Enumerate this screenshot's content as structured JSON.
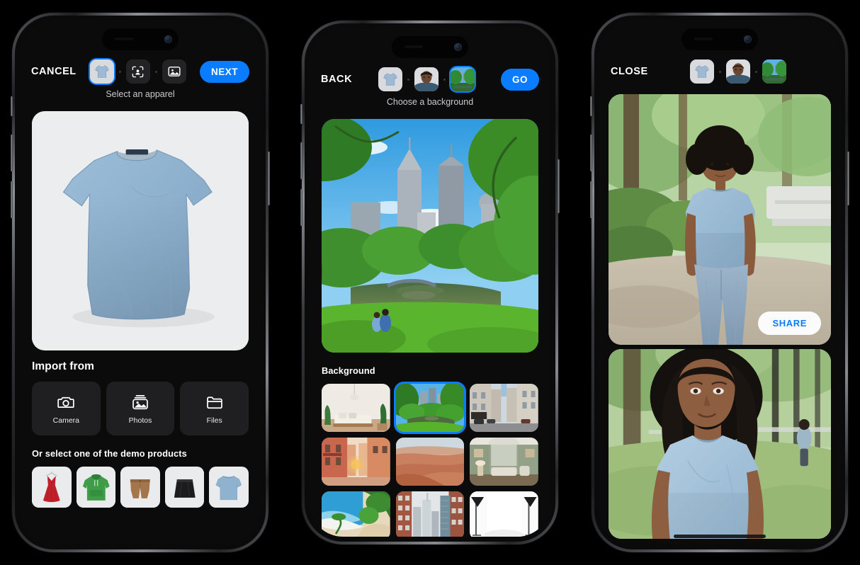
{
  "app": {
    "accent": "#0a7cff",
    "screen_bg": "#0b0b0c",
    "shirt_color": "#8fb2cf"
  },
  "phone1": {
    "nav_label": "CANCEL",
    "cta_label": "NEXT",
    "caption": "Select an apparel",
    "chips": [
      {
        "name": "apparel-chip",
        "icon": "tshirt-thumbnail",
        "selected": true
      },
      {
        "name": "model-chip",
        "icon": "face-scan-icon",
        "selected": false
      },
      {
        "name": "background-chip",
        "icon": "image-icon",
        "selected": false
      }
    ],
    "preview_alt": "light blue crew-neck t-shirt on white background",
    "import_title": "Import from",
    "import_options": [
      {
        "label": "Camera",
        "icon": "camera-icon"
      },
      {
        "label": "Photos",
        "icon": "photos-icon"
      },
      {
        "label": "Files",
        "icon": "folder-icon"
      }
    ],
    "demo_title": "Or select one of the demo products",
    "demo_products": [
      {
        "name": "red-dress",
        "color": "#c0202a"
      },
      {
        "name": "green-hoodie",
        "color": "#3d9a46"
      },
      {
        "name": "brown-shorts",
        "color": "#a3764c"
      },
      {
        "name": "black-skirt",
        "color": "#1d1d1f"
      },
      {
        "name": "blue-tshirt",
        "color": "#8fb2cf"
      }
    ]
  },
  "phone2": {
    "nav_label": "BACK",
    "cta_label": "GO",
    "caption": "Choose a background",
    "chips": [
      {
        "name": "apparel-chip",
        "icon": "tshirt-thumbnail",
        "selected": false
      },
      {
        "name": "model-chip",
        "icon": "model-portrait",
        "selected": false
      },
      {
        "name": "background-chip",
        "icon": "park-thumbnail",
        "selected": true
      }
    ],
    "hero_alt": "city park with lake, bridge and skyscrapers framed by green trees",
    "section_title": "Background",
    "backgrounds": [
      {
        "name": "bright-living-room",
        "selected": false
      },
      {
        "name": "city-park-lake",
        "selected": true
      },
      {
        "name": "paris-street",
        "selected": false
      },
      {
        "name": "italian-alley",
        "selected": false
      },
      {
        "name": "desert-dunes",
        "selected": false
      },
      {
        "name": "classic-green-lounge",
        "selected": false
      },
      {
        "name": "tropical-beach",
        "selected": false
      },
      {
        "name": "downtown-skyscrapers",
        "selected": false
      },
      {
        "name": "white-photo-studio",
        "selected": false
      }
    ]
  },
  "phone3": {
    "nav_label": "CLOSE",
    "chips": [
      {
        "name": "apparel-chip",
        "icon": "tshirt-thumbnail",
        "selected": false
      },
      {
        "name": "model-chip",
        "icon": "model-portrait",
        "selected": false
      },
      {
        "name": "background-chip",
        "icon": "park-thumbnail",
        "selected": false
      }
    ],
    "share_label": "SHARE",
    "result_top_alt": "full-body model in light blue t-shirt and jeans on a park path",
    "result_bottom_alt": "close-up of model wearing the light blue t-shirt in a park"
  }
}
